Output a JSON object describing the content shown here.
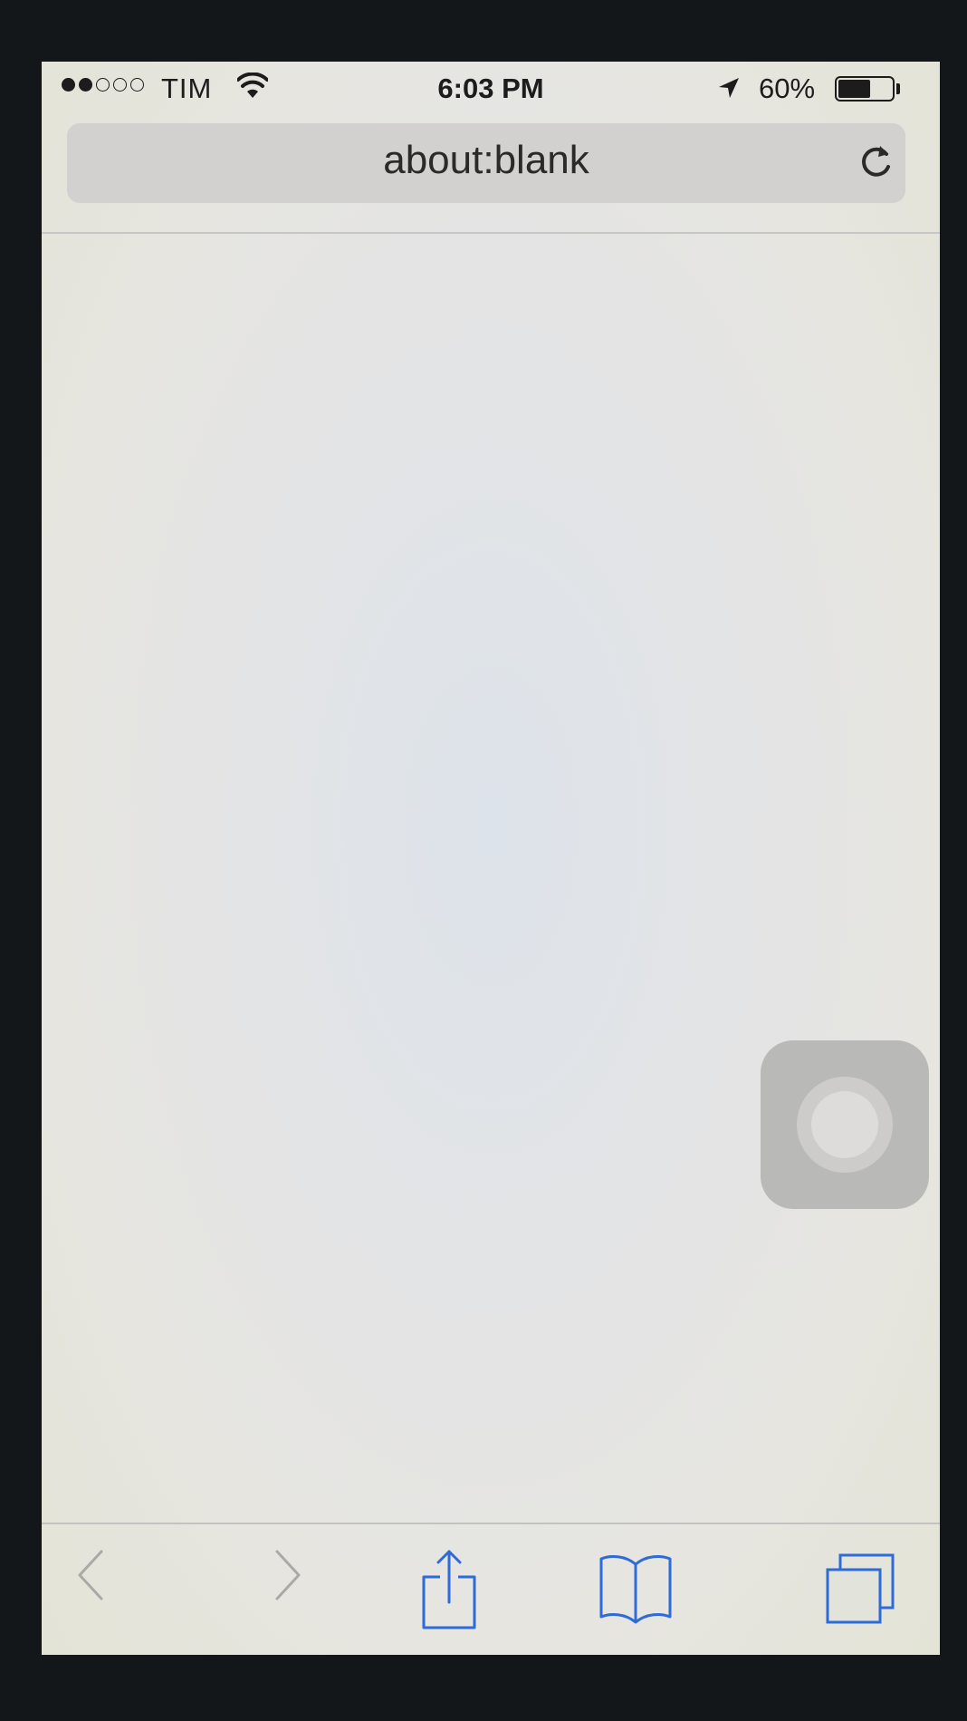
{
  "status_bar": {
    "signal_bars_filled": 2,
    "signal_bars_total": 5,
    "carrier": "TIM",
    "wifi_icon": "wifi-icon",
    "time": "6:03 PM",
    "location_icon": "location-arrow-icon",
    "battery_percent": "60%",
    "battery_level": 0.6
  },
  "address_bar": {
    "url": "about:blank",
    "reload_icon": "reload-icon"
  },
  "assistive_touch": {
    "icon": "assistive-touch-icon"
  },
  "toolbar": {
    "items": [
      {
        "name": "back",
        "icon": "chevron-left-icon",
        "enabled": false
      },
      {
        "name": "forward",
        "icon": "chevron-right-icon",
        "enabled": false
      },
      {
        "name": "share",
        "icon": "share-icon",
        "enabled": true
      },
      {
        "name": "bookmarks",
        "icon": "book-icon",
        "enabled": true
      },
      {
        "name": "tabs",
        "icon": "tabs-icon",
        "enabled": true
      }
    ]
  },
  "colors": {
    "accent": "#2f6bd8",
    "disabled": "#a9aaa8",
    "text": "#1c1c1c"
  }
}
